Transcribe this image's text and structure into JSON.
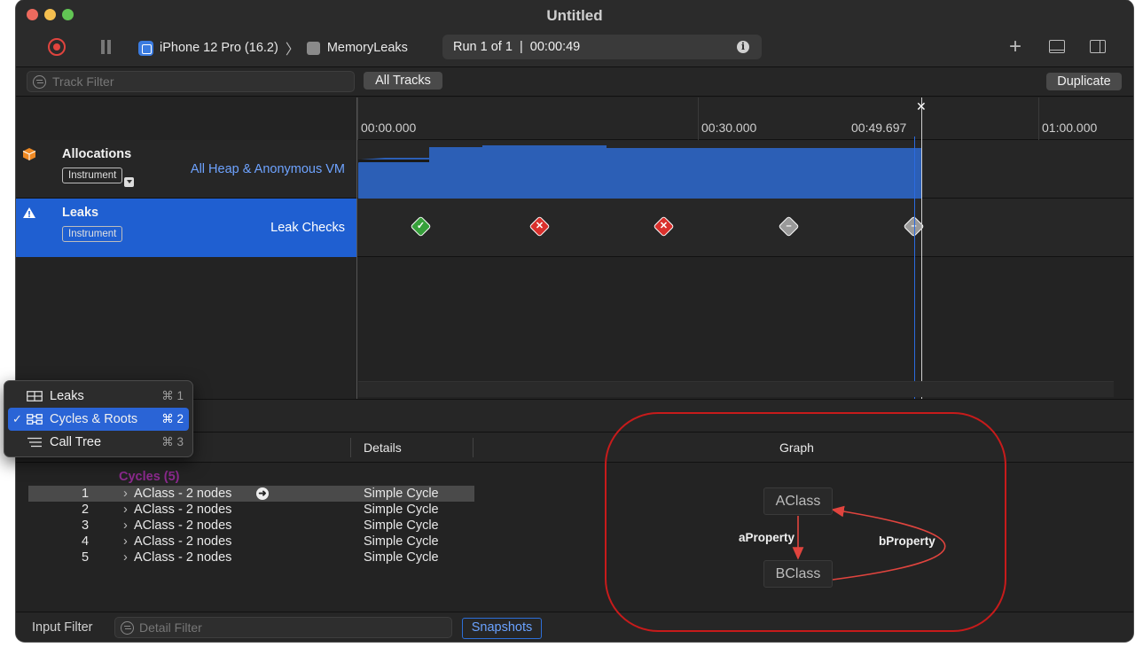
{
  "window": {
    "title": "Untitled"
  },
  "toolbar": {
    "device": "iPhone 12 Pro (16.2)",
    "app": "MemoryLeaks",
    "run_status": "Run 1 of 1  |  00:00:49"
  },
  "filters": {
    "track_filter_placeholder": "Track Filter",
    "all_tracks_label": "All Tracks",
    "duplicate_label": "Duplicate"
  },
  "ruler": {
    "ticks": [
      "00:00.000",
      "00:30.000",
      "00:49.697",
      "01:00.000"
    ]
  },
  "tracks": [
    {
      "name": "Allocations",
      "badge": "Instrument",
      "subtitle": "All Heap & Anonymous VM"
    },
    {
      "name": "Leaks",
      "badge": "Instrument",
      "subtitle": "Leak Checks"
    }
  ],
  "leak_checks": [
    "ok",
    "leak",
    "leak",
    "none",
    "none"
  ],
  "view_menu": {
    "items": [
      {
        "label": "Leaks",
        "shortcut": "⌘ 1",
        "selected": false
      },
      {
        "label": "Cycles & Roots",
        "shortcut": "⌘ 2",
        "selected": true
      },
      {
        "label": "Call Tree",
        "shortcut": "⌘ 3",
        "selected": false
      }
    ]
  },
  "table": {
    "col_details": "Details",
    "col_graph": "Graph",
    "group_label": "Cycles (5)",
    "rows": [
      {
        "index": "1",
        "name": "AClass - 2 nodes",
        "details": "Simple Cycle"
      },
      {
        "index": "2",
        "name": "AClass - 2 nodes",
        "details": "Simple Cycle"
      },
      {
        "index": "3",
        "name": "AClass - 2 nodes",
        "details": "Simple Cycle"
      },
      {
        "index": "4",
        "name": "AClass - 2 nodes",
        "details": "Simple Cycle"
      },
      {
        "index": "5",
        "name": "AClass - 2 nodes",
        "details": "Simple Cycle"
      }
    ]
  },
  "graph": {
    "node_a": "AClass",
    "node_b": "BClass",
    "edge_a_to_b": "aProperty",
    "edge_b_to_a": "bProperty"
  },
  "bottom": {
    "input_filter_label": "Input Filter",
    "detail_filter_placeholder": "Detail Filter",
    "snapshots_label": "Snapshots"
  },
  "colors": {
    "accent": "#1f5fd1",
    "annotation_ring": "#c71b1b",
    "graph_edge": "#e0443e"
  }
}
